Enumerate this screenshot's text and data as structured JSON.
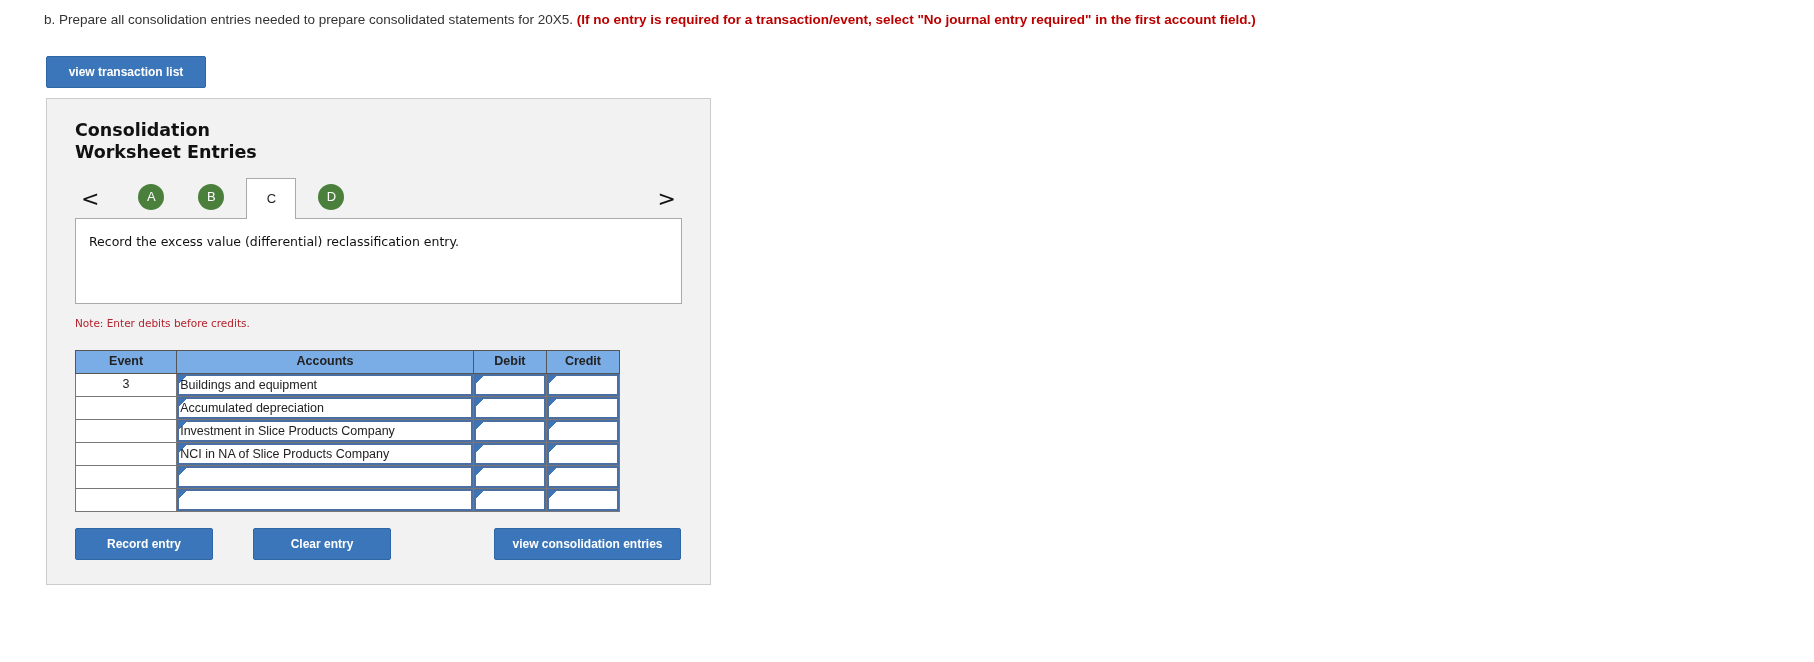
{
  "instruction": {
    "prefix": "b. Prepare all consolidation entries needed to prepare consolidated statements for 20X5.",
    "emphasis": "(If no entry is required for a transaction/event, select \"No journal entry required\" in the first account field.)"
  },
  "top_button": "view transaction list",
  "panel": {
    "title_lines": [
      "Consolidation",
      "Worksheet Entries"
    ],
    "prev": "<",
    "next": ">",
    "tabs": [
      {
        "label": "A",
        "selected": false
      },
      {
        "label": "B",
        "selected": false
      },
      {
        "label": "C",
        "selected": true
      },
      {
        "label": "D",
        "selected": false
      }
    ],
    "prompt": "Record the excess value (differential) reclassification entry.",
    "note": "Note: Enter debits before credits.",
    "table": {
      "columns": [
        "Event",
        "Accounts",
        "Debit",
        "Credit"
      ],
      "rows": [
        {
          "event": "3",
          "account": "Buildings and equipment"
        },
        {
          "account": "Accumulated depreciation"
        },
        {
          "account": "Investment in Slice Products Company"
        },
        {
          "account": "NCI in NA of Slice Products Company"
        },
        {},
        {}
      ]
    },
    "buttons": [
      "Record entry",
      "Clear entry",
      "view consolidation entries"
    ]
  }
}
